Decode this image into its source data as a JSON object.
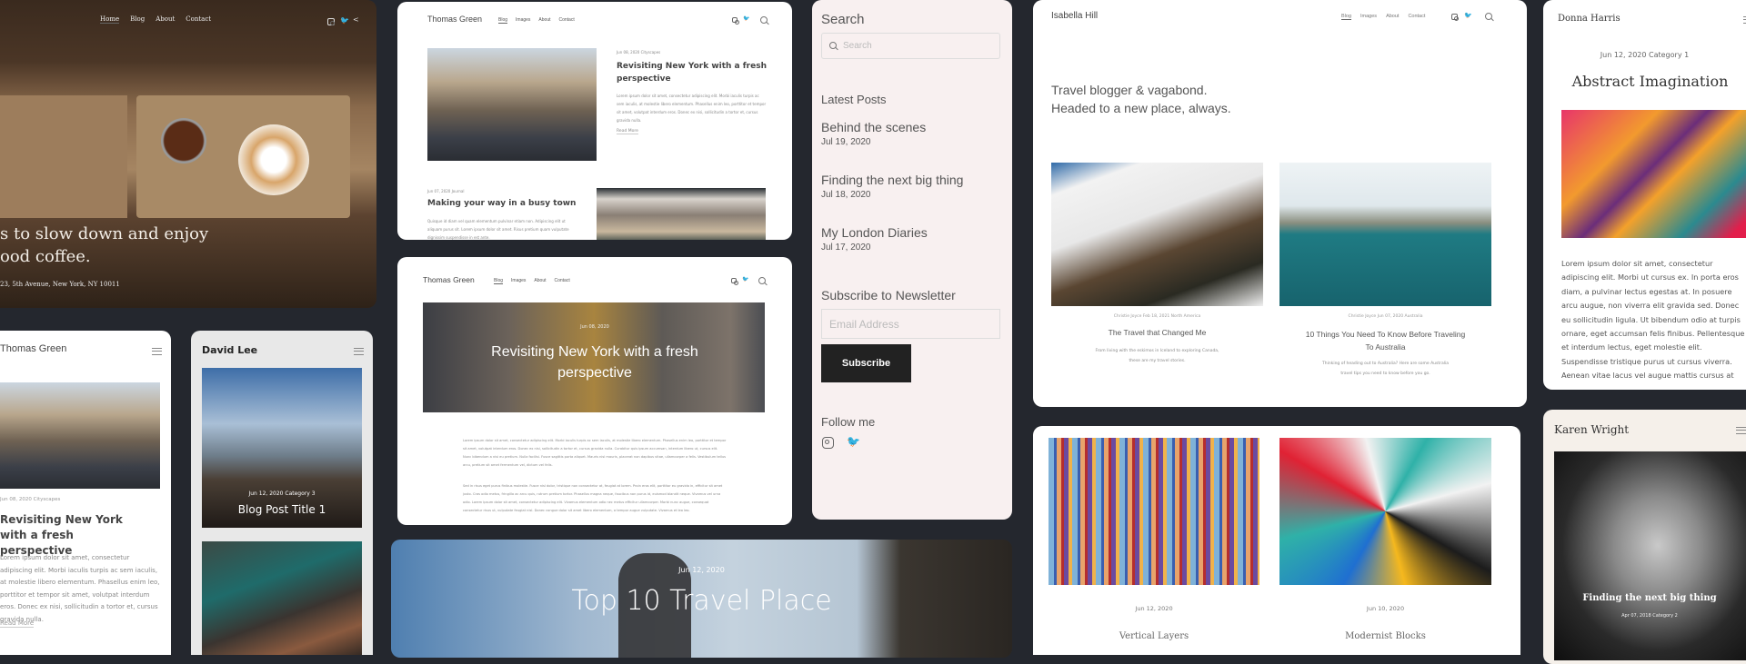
{
  "colors": {
    "background": "#24272e",
    "sidebar_bg": "#f8f0f0",
    "david_bg": "#e8e8e8",
    "karen_bg": "#f5f0ea",
    "button_dark": "#222222"
  },
  "coffee": {
    "nav": [
      "Home",
      "Blog",
      "About",
      "Contact"
    ],
    "headline": [
      "s to slow down and enjoy",
      "ood coffee."
    ],
    "address": "23, 5th Avenue, New York, NY 10011",
    "icons": [
      "instagram-icon",
      "twitter-icon",
      "share-icon"
    ]
  },
  "tg_desktop": {
    "name": "Thomas Green",
    "nav": [
      "Blog",
      "Images",
      "About",
      "Contact"
    ],
    "post1": {
      "meta": "Jun 08, 2020   Cityscapes",
      "title": "Revisiting New York with a fresh perspective",
      "body": "Lorem ipsum dolor sit amet, consectetur adipiscing elit. Morbi iaculis turpis ac sem iaculis, at molestie libero elementum. Phasellus enim leo, porttitor et tempor sit amet, volutpat interdum eros. Donec ex nisi, sollicitudin a tortor et, cursus gravida nulla.",
      "link": "Read More"
    },
    "post2": {
      "meta": "Jun 07, 2020   Journal",
      "title": "Making your way in a busy town",
      "body": "Quisque id diam vel quam elementum pulvinar etiam non. Adipiscing elit ut aliquam purus sit. Lorem ipsum dolor sit amet. Risus pretium quam vulputate dignissim suspendisse in est ante."
    }
  },
  "tg_post": {
    "name": "Thomas Green",
    "nav": [
      "Blog",
      "Images",
      "About",
      "Contact"
    ],
    "date": "Jun 08, 2020",
    "title": "Revisiting New York with a fresh perspective",
    "para1": "Lorem ipsum dolor sit amet, consectetur adipiscing elit. Morbi iaculis turpis ac sem iaculis, at molestie libero elementum. Phasellus enim leo, porttitor et tempor sit amet, volutpat interdum eros. Donec ex nisi, sollicitudin a tortor et, cursus gravida nulla. Curabitur quis ipsum accumsan, interdum libero ut, cursus elit. Nunc bibendum a nisi eu pretium. Nulla facilisi. Fusce sagittis porta aliquet. Mauris nisl mauris, placerat non dapibus vitae, ullamcorper a felis. Vestibulum tellus arcu, pretium sit amet fermentum vel, dictum vel felis.",
    "para2": "Sed in risus eget purus finibus molestie. Fusce nisl dolor, tristique non consectetur at, feugiat at lorem. Proin eros elit, porttitor eu gravida in, efficitur sit amet justo. Cras odio metus, fringilla ac arcu quis, rutrum pretium tortor. Phasellus magna neque, faucibus non purus id, euismod blandit neque. Vivamus vel urna odio. Lorem ipsum dolor sit amet, consectetur adipiscing elit. Vivamus elementum odio nec metus efficitur ullamcorper. Morbi nunc augue, consequat consectetur risus ut, vulputate feugiat nisl. Donec congue dolor sit amet libero elementum, a tempor augue vulputate. Vivamus et leo leo."
  },
  "sidebar": {
    "search_heading": "Search",
    "search_placeholder": "Search",
    "latest_heading": "Latest Posts",
    "posts": [
      {
        "title": "Behind the scenes",
        "date": "Jul 19, 2020"
      },
      {
        "title": "Finding the next big thing",
        "date": "Jul 18, 2020"
      },
      {
        "title": "My London Diaries",
        "date": "Jul 17, 2020"
      }
    ],
    "newsletter_heading": "Subscribe to Newsletter",
    "email_placeholder": "Email Address",
    "subscribe_label": "Subscribe",
    "follow_heading": "Follow me"
  },
  "isabella": {
    "name": "Isabella Hill",
    "nav": [
      "Blog",
      "Images",
      "About",
      "Contact"
    ],
    "tagline": [
      "Travel blogger & vagabond.",
      "Headed to a new place, always."
    ],
    "posts": [
      {
        "meta": "Christie Joyce   Feb 18, 2021   North America",
        "title": "The Travel that Changed Me",
        "desc": "From living with the eskimos in Iceland to exploring Canada, these are my travel stories."
      },
      {
        "meta": "Christie Joyce   Jun 07, 2020   Australia",
        "title": "10 Things You Need To Know Before Traveling To Australia",
        "desc": "Thinking of heading out to Australia? Here are some Australia travel tips you need to know before you go."
      }
    ]
  },
  "donna": {
    "name": "Donna Harris",
    "meta": "Jun 12, 2020   Category 1",
    "title": "Abstract Imagination",
    "body": "Lorem ipsum dolor sit amet, consectetur adipiscing elit. Morbi ut cursus ex. In porta eros diam, a pulvinar lectus egestas at. In posuere arcu augue, non viverra elit gravida sed. Donec eu sollicitudin ligula. Ut bibendum odio at turpis ornare, eget accumsan felis finibus. Pellentesque et interdum lectus, eget molestie elit. Suspendisse tristique purus ut cursus viverra. Aenean vitae lacus vel augue mattis cursus at"
  },
  "tg_mobile": {
    "name": "Thomas Green",
    "meta": "Jun 08, 2020   Cityscapes",
    "title": "Revisiting New York with a fresh perspective",
    "body": "Lorem ipsum dolor sit amet, consectetur adipiscing elit. Morbi iaculis turpis ac sem iaculis, at molestie libero elementum. Phasellus enim leo, porttitor et tempor sit amet, volutpat interdum eros. Donec ex nisi, sollicitudin a tortor et, cursus gravida nulla.",
    "link": "Read More"
  },
  "david": {
    "name": "David Lee",
    "meta": "Jun 12, 2020    Category 3",
    "title": "Blog Post Title 1"
  },
  "travel": {
    "date": "Jun 12, 2020",
    "title": "Top 10 Travel Place"
  },
  "art": {
    "posts": [
      {
        "date": "Jun 12, 2020",
        "title": "Vertical Layers"
      },
      {
        "date": "Jun 10, 2020",
        "title": "Modernist Blocks"
      }
    ]
  },
  "karen": {
    "name": "Karen Wright",
    "title": "Finding the next big thing",
    "meta": "Apr 07, 2018    Category 2"
  }
}
